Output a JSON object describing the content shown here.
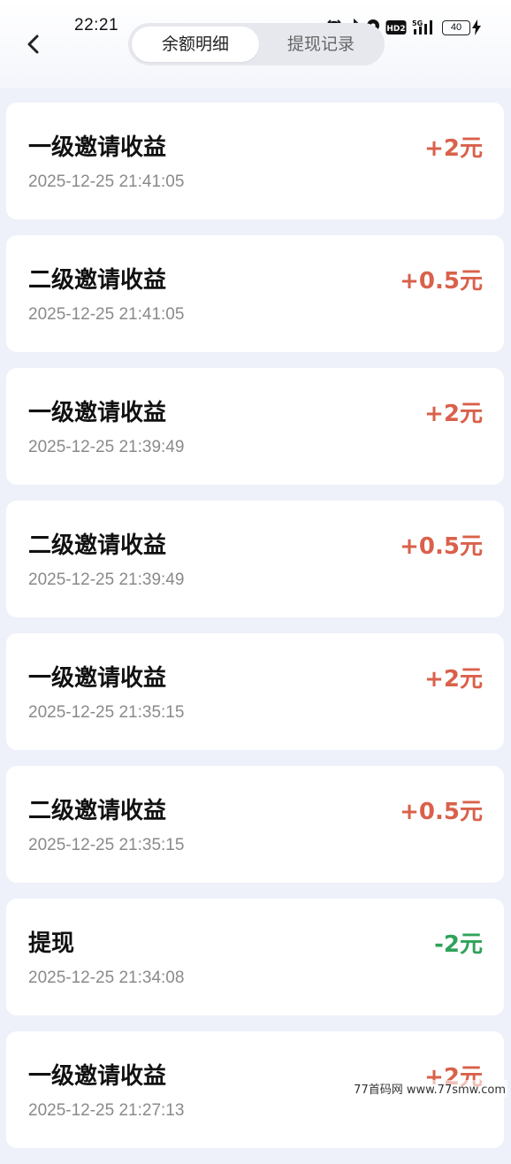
{
  "status_bar": {
    "time": "22:21",
    "network": "5G",
    "hd_badge": "HD2",
    "battery": "40",
    "icons": [
      "alarm-icon",
      "bluetooth-icon",
      "location-icon",
      "hd-icon",
      "signal-icon",
      "battery-icon",
      "charging-icon"
    ]
  },
  "header": {
    "back_icon": "chevron-left-icon",
    "tabs": [
      {
        "label": "余额明细",
        "active": true
      },
      {
        "label": "提现记录",
        "active": false
      }
    ]
  },
  "colors": {
    "income": "#d9614b",
    "expense": "#2fa35a",
    "background": "#eef1fa"
  },
  "records": [
    {
      "title": "一级邀请收益",
      "time": "2025-12-25 21:41:05",
      "amount": "+2元",
      "type": "income"
    },
    {
      "title": "二级邀请收益",
      "time": "2025-12-25 21:41:05",
      "amount": "+0.5元",
      "type": "income"
    },
    {
      "title": "一级邀请收益",
      "time": "2025-12-25 21:39:49",
      "amount": "+2元",
      "type": "income"
    },
    {
      "title": "二级邀请收益",
      "time": "2025-12-25 21:39:49",
      "amount": "+0.5元",
      "type": "income"
    },
    {
      "title": "一级邀请收益",
      "time": "2025-12-25 21:35:15",
      "amount": "+2元",
      "type": "income"
    },
    {
      "title": "二级邀请收益",
      "time": "2025-12-25 21:35:15",
      "amount": "+0.5元",
      "type": "income"
    },
    {
      "title": "提现",
      "time": "2025-12-25 21:34:08",
      "amount": "-2元",
      "type": "expense"
    },
    {
      "title": "一级邀请收益",
      "time": "2025-12-25 21:27:13",
      "amount": "+2元",
      "type": "income"
    }
  ],
  "watermark": "77首码网 www.77smw.com"
}
